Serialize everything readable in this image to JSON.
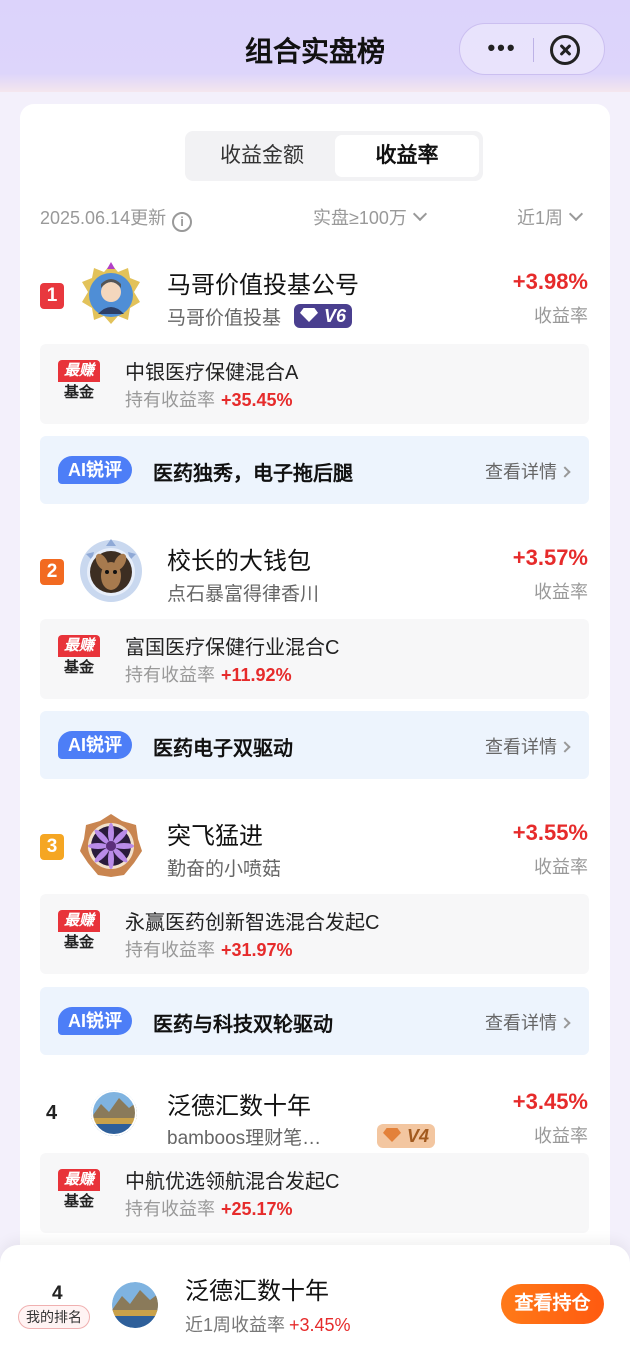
{
  "header": {
    "title": "组合实盘榜",
    "more": "•••"
  },
  "tabs": [
    {
      "label": "收益金额"
    },
    {
      "label": "收益率"
    }
  ],
  "filters": {
    "updated": "2025.06.14更新",
    "scale": "实盘≥100万",
    "period": "近1周"
  },
  "entries": [
    {
      "rank": "1",
      "name": "马哥价值投基公号",
      "owner": "马哥价值投基",
      "level": "V6",
      "return": "+3.98%",
      "return_label": "收益率",
      "fund": {
        "tag_top": "最赚",
        "tag_bottom": "基金",
        "name": "中银医疗保健混合A",
        "label": "持有收益率",
        "return": "+35.45%"
      },
      "ai": {
        "tag": "AI锐评",
        "text": "医药独秀，电子拖后腿",
        "link": "查看详情"
      }
    },
    {
      "rank": "2",
      "name": "校长的大钱包",
      "owner": "点石暴富得律香川",
      "return": "+3.57%",
      "return_label": "收益率",
      "fund": {
        "tag_top": "最赚",
        "tag_bottom": "基金",
        "name": "富国医疗保健行业混合C",
        "label": "持有收益率",
        "return": "+11.92%"
      },
      "ai": {
        "tag": "AI锐评",
        "text": "医药电子双驱动",
        "link": "查看详情"
      }
    },
    {
      "rank": "3",
      "name": "突飞猛进",
      "owner": "勤奋的小喷菇",
      "return": "+3.55%",
      "return_label": "收益率",
      "fund": {
        "tag_top": "最赚",
        "tag_bottom": "基金",
        "name": "永赢医药创新智选混合发起C",
        "label": "持有收益率",
        "return": "+31.97%"
      },
      "ai": {
        "tag": "AI锐评",
        "text": "医药与科技双轮驱动",
        "link": "查看详情"
      }
    },
    {
      "rank": "4",
      "name": "泛德汇数十年",
      "owner": "bamboos理财笔…",
      "level": "V4",
      "return": "+3.45%",
      "return_label": "收益率",
      "fund": {
        "tag_top": "最赚",
        "tag_bottom": "基金",
        "name": "中航优选领航混合发起C",
        "label": "持有收益率",
        "return": "+25.17%"
      }
    }
  ],
  "my": {
    "rank": "4",
    "tag": "我的排名",
    "name": "泛德汇数十年",
    "label": "近1周收益率",
    "return": "+3.45%",
    "button": "查看持仓"
  },
  "colors": {
    "accent_red": "#e62b2b",
    "ai_blue": "#4d7ef7",
    "orange": "#ff6a14",
    "rank1": "#e8383e",
    "rank2": "#f26a21",
    "rank3": "#f5a623"
  }
}
